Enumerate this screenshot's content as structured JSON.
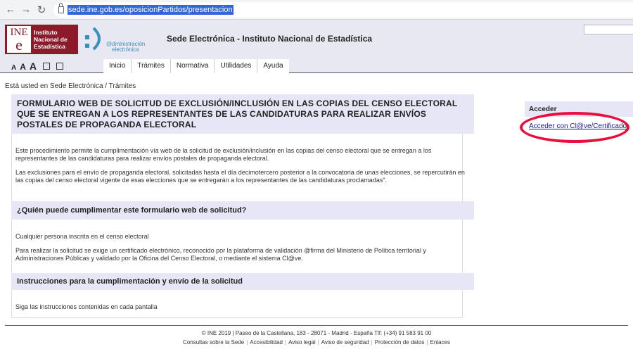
{
  "browser": {
    "url": "sede.ine.gob.es/oposicionPartidos/presentacion"
  },
  "header": {
    "logo_ine_mark_top": "INE",
    "logo_ine_mark_bottom": "e",
    "logo_ine_line1": "Instituto",
    "logo_ine_line2": "Nacional de",
    "logo_ine_line3": "Estadística",
    "logo_admin_line1": "@dministración",
    "logo_admin_line2": "electrónica",
    "site_title": "Sede Electrónica - Instituto Nacional de Estadística",
    "font_size_labels": [
      "A",
      "A",
      "A"
    ],
    "menu": [
      "Inicio",
      "Trámites",
      "Normativa",
      "Utilidades",
      "Ayuda"
    ]
  },
  "breadcrumb": "Está usted en Sede Electrónica / Trámites",
  "main": {
    "title": "FORMULARIO WEB DE SOLICITUD DE EXCLUSIÓN/INCLUSIÓN EN LAS COPIAS DEL CENSO ELECTORAL QUE SE ENTREGAN A LOS REPRESENTANTES DE LAS CANDIDATURAS PARA REALIZAR ENVÍOS POSTALES DE PROPAGANDA ELECTORAL",
    "intro_p1": "Este procedimiento permite la cumplimentación vía web de la solicitud de exclusión/inclusión en las copias del censo electoral que se entregan a los representantes de las candidaturas para realizar envíos postales de propaganda electoral.",
    "intro_p2": "Las exclusiones para el envío de propaganda electoral, solicitadas hasta el día decimotercero posterior a la convocatoria de unas elecciones, se repercutirán en las copias del censo electoral vigente de esas elecciones que se entregarán a los representantes de las candidaturas proclamadas\".",
    "section2_title": "¿Quién puede cumplimentar este formulario web de solicitud?",
    "section2_p1": "Cualquier persona inscrita en el censo electoral",
    "section2_p2": "Para realizar la solicitud se exige un certificado electrónico, reconocido por la plataforma de validación @firma del Ministerio de Política territorial y Administraciones Públicas y validado por la Oficina del Censo Electoral, o mediante el sistema Cl@ve.",
    "section3_title": "Instrucciones para la cumplimentación y envío de la solicitud",
    "section3_p1": "Siga las instrucciones contenidas en cada pantalla"
  },
  "sidebar": {
    "heading": "Acceder",
    "link": "Acceder con Cl@ve/Certificado"
  },
  "footer": {
    "line1": "© INE 2019  |  Paseo de la Castellana, 183 - 28071 - Madrid - España Tlf: (+34) 91 583 91 00",
    "links": [
      "Consultas sobre la Sede",
      "Accesibilidad",
      "Aviso legal",
      "Aviso de seguridad",
      "Protección de datos",
      "Enlaces"
    ]
  },
  "colors": {
    "ine_brand": "#8c1a2a",
    "section_bg": "#e6e6f7",
    "highlight_ellipse": "#e8103a",
    "link": "#1a1a8c"
  }
}
